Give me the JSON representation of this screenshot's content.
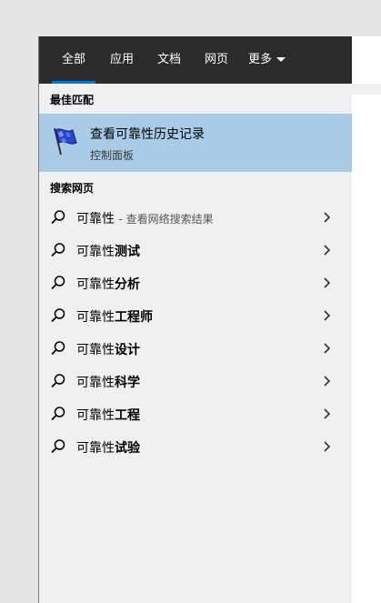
{
  "tabs": [
    {
      "label": "全部",
      "active": true
    },
    {
      "label": "应用"
    },
    {
      "label": "文档"
    },
    {
      "label": "网页"
    },
    {
      "label": "更多"
    }
  ],
  "best_match": {
    "heading": "最佳匹配",
    "title": "查看可靠性历史记录",
    "subtitle": "控制面板",
    "icon": "reliability-flag-icon"
  },
  "web_search": {
    "heading": "搜索网页",
    "first": {
      "term": "可靠性",
      "suffix": "- 查看网络搜索结果"
    },
    "query_prefix": "可靠性",
    "suggestions": [
      "测试",
      "分析",
      "工程师",
      "设计",
      "科学",
      "工程",
      "试验"
    ]
  },
  "colors": {
    "topbar": "#2b2b2b",
    "accent": "#0078d7",
    "selected": "#a9cbe8",
    "panel": "#f0f0f0"
  }
}
